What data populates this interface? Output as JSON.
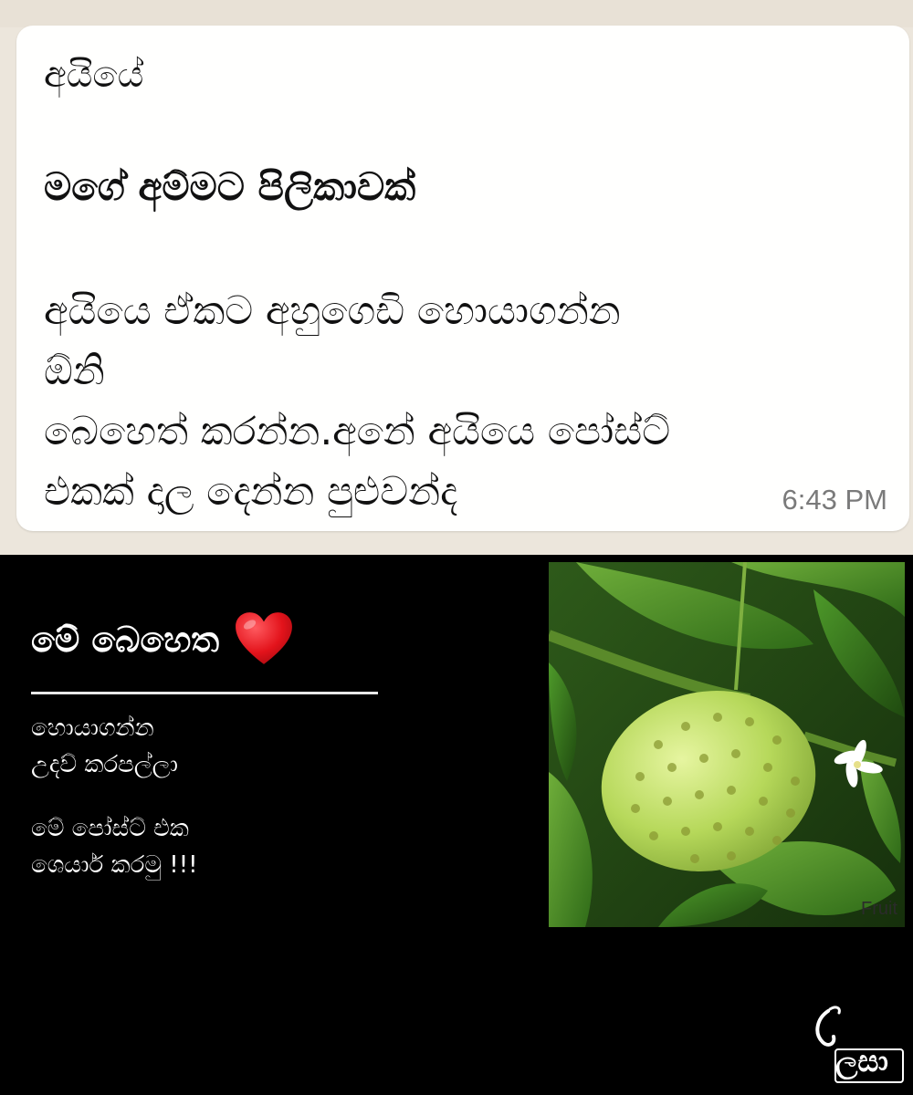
{
  "message": {
    "greeting": "අයියේ",
    "title": "මගේ අම්මට පිලිකාවක්",
    "body_lines": [
      "අයියෙ ඒකට අහුගෙඩි හොයාගන්න",
      "ඕනි",
      "බෙහෙත් කරන්න.අනේ අයියෙ පෝස්ට්",
      "එකක් දාල දෙන්න පුළුවන්ද"
    ],
    "time": "6:43 PM"
  },
  "post": {
    "heading": "මේ බෙහෙත",
    "heart_icon": "red-heart-icon",
    "line1": "හොයාගන්න",
    "line2": "උදව් කරපල්ලා",
    "line3": "මේ පෝස්ට් එක",
    "line4": "ශෙයාර් කරමු !!!",
    "photo_label": "Fruit"
  },
  "logo": {
    "text": "ලසා"
  },
  "colors": {
    "bubble_bg": "#fffffe",
    "chat_bg": "#ece6dc",
    "time_color": "#7a7a7a",
    "heart": "#e3131b",
    "fruit": "#b6d85a"
  }
}
